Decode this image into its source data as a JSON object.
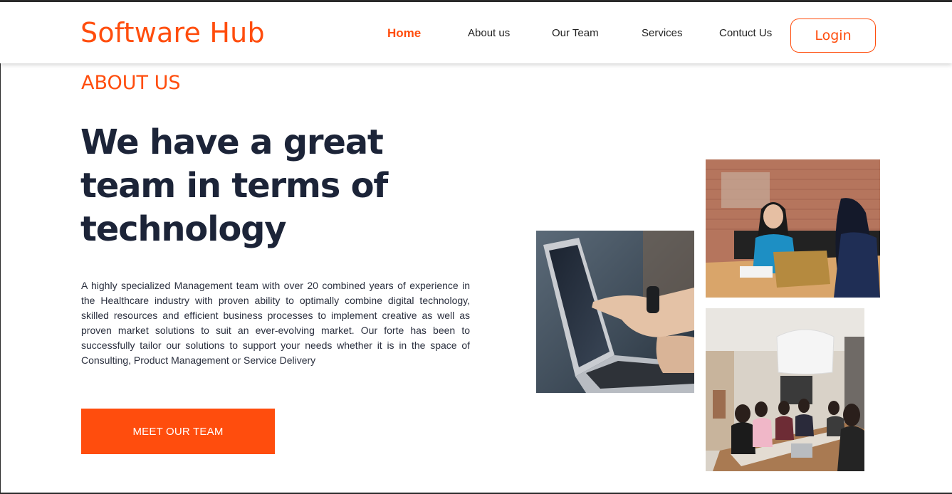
{
  "brand": {
    "name": "Software Hub"
  },
  "nav": {
    "items": [
      {
        "label": "Home",
        "active": true
      },
      {
        "label": "About us",
        "active": false
      },
      {
        "label": "Our Team",
        "active": false
      },
      {
        "label": "Services",
        "active": false
      },
      {
        "label": "Contuct Us",
        "active": false
      }
    ],
    "login_label": "Login"
  },
  "about": {
    "section_label": "ABOUT US",
    "headline": "We have a great team in terms of technology",
    "description": "A highly specialized Management team with over 20 combined years of experience in the Healthcare industry with proven ability to optimally combine digital technology, skilled resources and efficient business processes to implement creative as well as proven market solutions to suit an ever-evolving market. Our forte has been to successfully tailor our solutions to support your needs whether it is in the space of Consulting, Product Management or Service Delivery",
    "cta_label": "MEET OUR TEAM"
  },
  "images": [
    {
      "name": "laptop-pointing-photo"
    },
    {
      "name": "two-women-meeting-photo"
    },
    {
      "name": "conference-room-photo"
    }
  ],
  "colors": {
    "accent": "#ff4d0d",
    "heading": "#1c2438",
    "body_text": "#2a2f3e"
  }
}
